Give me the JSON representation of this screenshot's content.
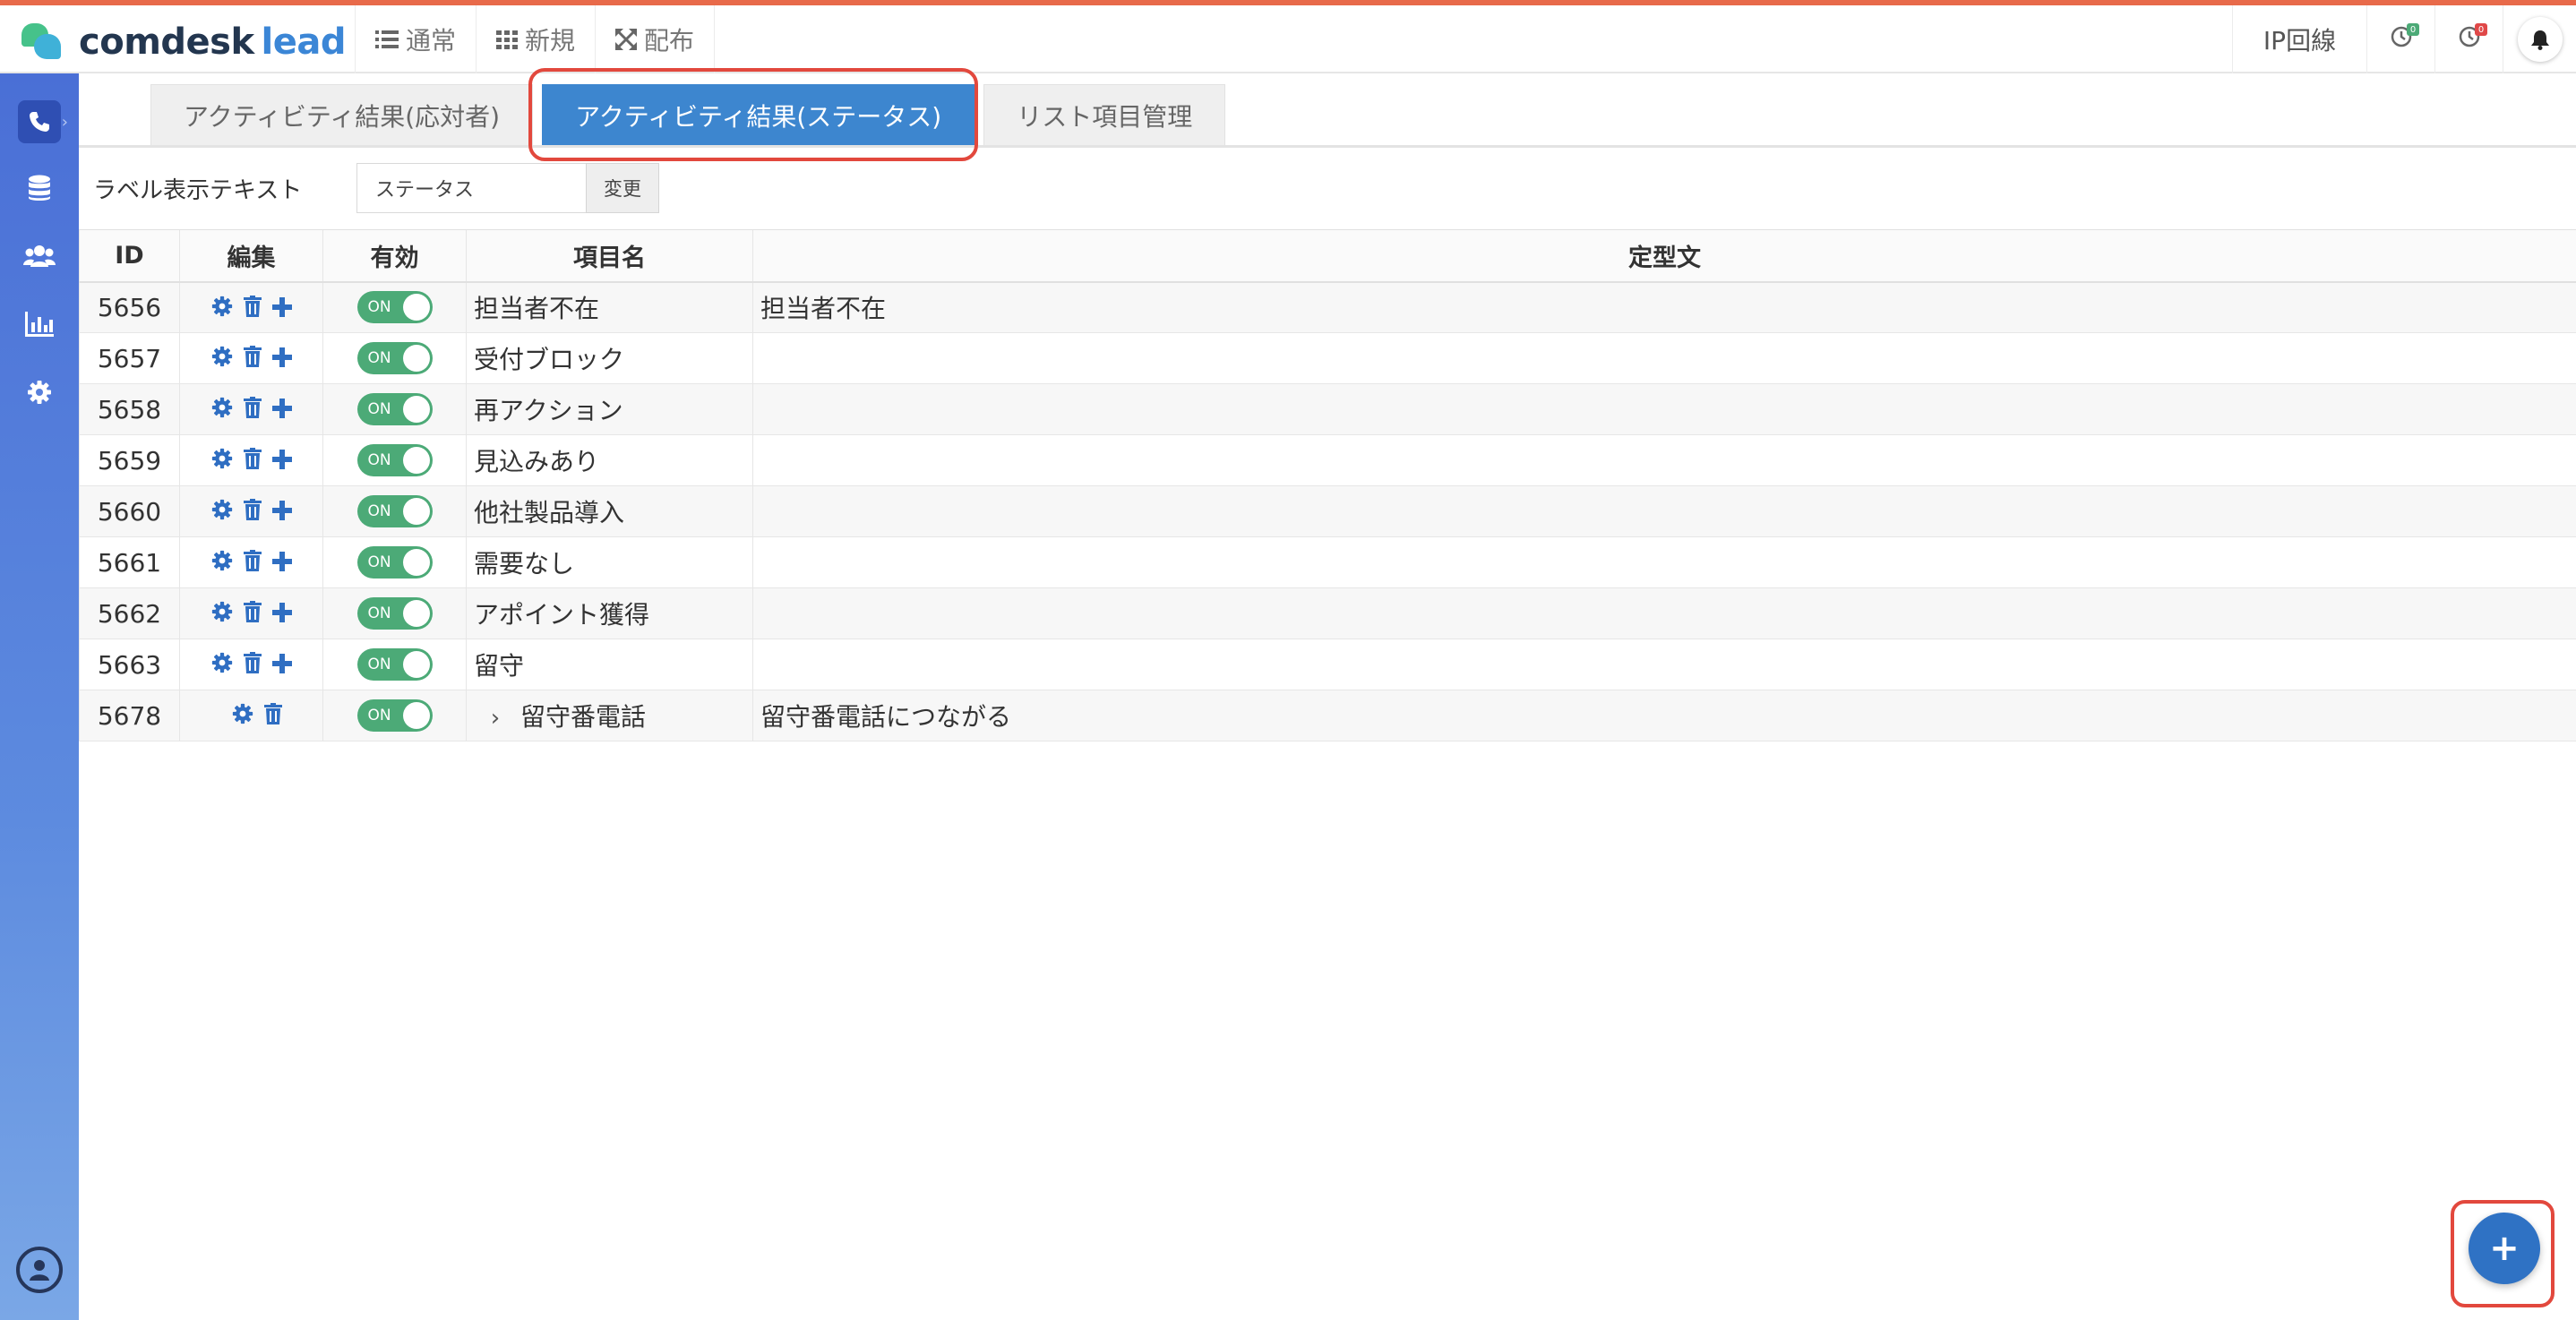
{
  "app": {
    "logo_name": "comdesk",
    "logo_suffix": "lead"
  },
  "nav": [
    {
      "label": "通常",
      "icon": "list-icon"
    },
    {
      "label": "新規",
      "icon": "grid-icon"
    },
    {
      "label": "配布",
      "icon": "expand-icon"
    }
  ],
  "topright": {
    "ip_label": "IP回線",
    "clock1_badge": "0",
    "clock2_badge": "0"
  },
  "sidebar": {
    "items": [
      "phone-icon",
      "database-icon",
      "users-icon",
      "chart-icon",
      "gear-icon"
    ],
    "user_icon": "user-circle-icon"
  },
  "tabs": [
    {
      "label": "アクティビティ結果(応対者)",
      "active": false
    },
    {
      "label": "アクティビティ結果(ステータス)",
      "active": true
    },
    {
      "label": "リスト項目管理",
      "active": false
    }
  ],
  "label_setting": {
    "title": "ラベル表示テキスト",
    "value": "ステータス",
    "button": "変更"
  },
  "table": {
    "headers": [
      "ID",
      "編集",
      "有効",
      "項目名",
      "定型文"
    ],
    "toggle_on_label": "ON",
    "rows": [
      {
        "id": "5656",
        "name": "担当者不在",
        "text": "担当者不在"
      },
      {
        "id": "5657",
        "name": "受付ブロック",
        "text": ""
      },
      {
        "id": "5658",
        "name": "再アクション",
        "text": ""
      },
      {
        "id": "5659",
        "name": "見込みあり",
        "text": ""
      },
      {
        "id": "5660",
        "name": "他社製品導入",
        "text": ""
      },
      {
        "id": "5661",
        "name": "需要なし",
        "text": ""
      },
      {
        "id": "5662",
        "name": "アポイント獲得",
        "text": ""
      },
      {
        "id": "5663",
        "name": "留守",
        "text": ""
      },
      {
        "id": "5678",
        "name": "留守番電話",
        "text": "留守番電話につながる"
      }
    ],
    "expander_symbol": "›"
  },
  "fab": {
    "symbol": "+"
  },
  "colors": {
    "accent": "#3d86cf",
    "toggle_on": "#4caa77",
    "highlight": "#e2483d",
    "topbar_stripe": "#e86a4a"
  }
}
